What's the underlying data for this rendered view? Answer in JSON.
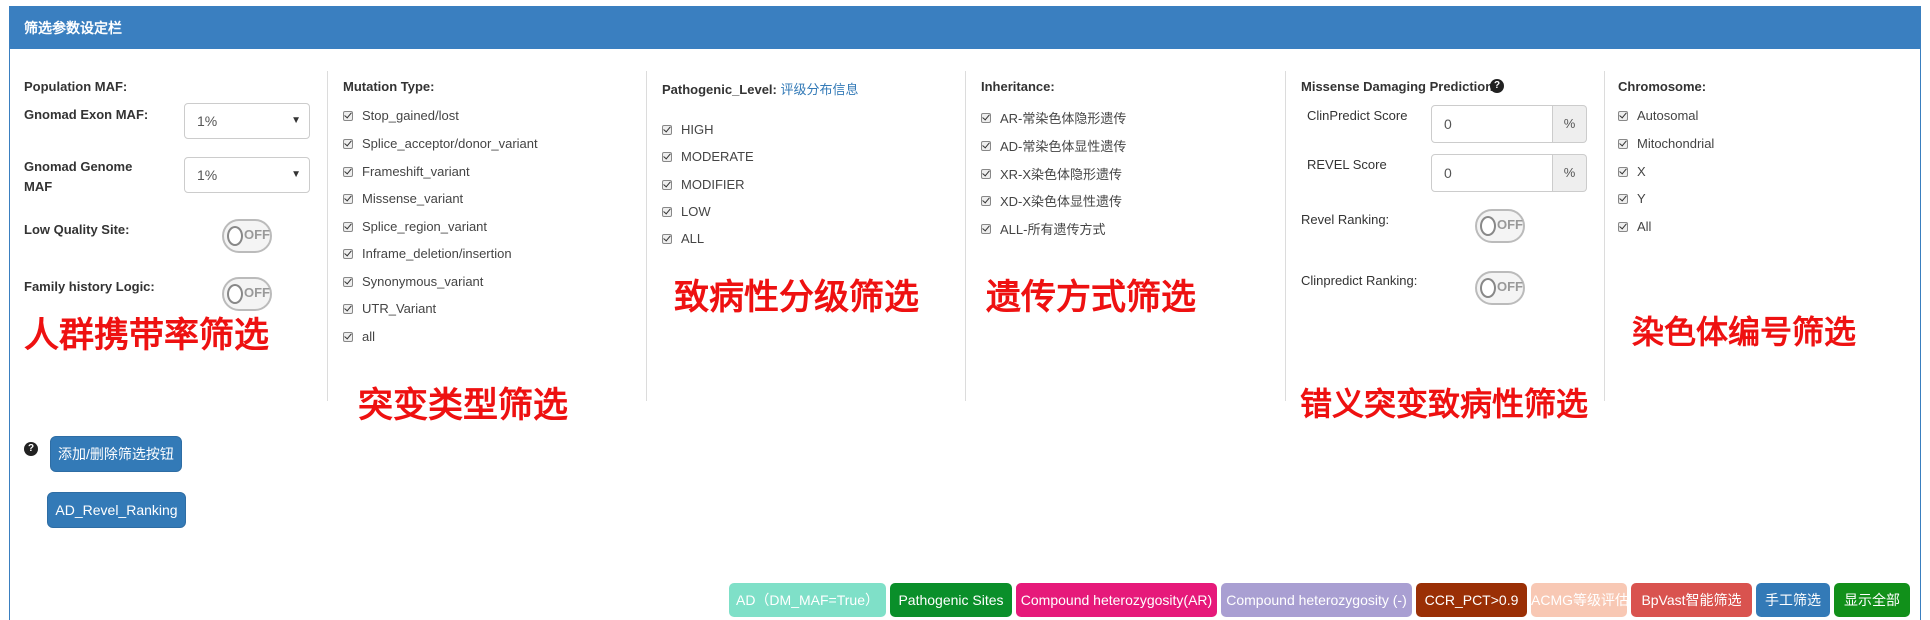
{
  "header": {
    "title": "筛选参数设定栏"
  },
  "population": {
    "title": "Population MAF:",
    "exon_label": "Gnomad Exon MAF:",
    "exon_value": "1%",
    "genome_label_1": "Gnomad Genome",
    "genome_label_2": "MAF",
    "genome_value": "1%",
    "low_quality_label": "Low Quality Site:",
    "family_label": "Family history Logic:",
    "toggle_off": "OFF"
  },
  "mutation": {
    "title": "Mutation Type:",
    "items": [
      "Stop_gained/lost",
      "Splice_acceptor/donor_variant",
      "Frameshift_variant",
      "Missense_variant",
      "Splice_region_variant",
      "Inframe_deletion/insertion",
      "Synonymous_variant",
      "UTR_Variant",
      "all"
    ]
  },
  "pathogenic": {
    "title": "Pathogenic_Level:",
    "link": "评级分布信息",
    "items": [
      "HIGH",
      "MODERATE",
      "MODIFIER",
      "LOW",
      "ALL"
    ]
  },
  "inheritance": {
    "title": "Inheritance:",
    "items": [
      "AR-常染色体隐形遗传",
      "AD-常染色体显性遗传",
      "XR-X染色体隐形遗传",
      "XD-X染色体显性遗传",
      "ALL-所有遗传方式"
    ]
  },
  "missense": {
    "title": "Missense Damaging Prediction:",
    "clinpredict_label": "ClinPredict Score",
    "clinpredict_value": "0",
    "revel_label": "REVEL Score",
    "revel_value": "0",
    "percent": "%",
    "revel_ranking_label": "Revel Ranking:",
    "clinpredict_ranking_label": "Clinpredict Ranking:"
  },
  "chromosome": {
    "title": "Chromosome:",
    "items": [
      "Autosomal",
      "Mitochondrial",
      "X",
      "Y",
      "All"
    ]
  },
  "annotations": {
    "population": "人群携带率筛选",
    "mutation": "突变类型筛选",
    "pathogenic": "致病性分级筛选",
    "inheritance": "遗传方式筛选",
    "missense": "错义突变致病性筛选",
    "chromosome": "染色体编号筛选"
  },
  "buttons": {
    "add_remove": "添加/删除筛选按钮",
    "ad_revel": "AD_Revel_Ranking"
  },
  "filters": [
    {
      "label": "AD（DM_MAF=True）",
      "color": "#7fe0c8"
    },
    {
      "label": "Pathogenic Sites",
      "color": "#0a8f2a"
    },
    {
      "label": "Compound heterozygosity(AR)",
      "color": "#e6197a"
    },
    {
      "label": "Compound heterozygosity (-)",
      "color": "#a99fd2"
    },
    {
      "label": "CCR_PCT>0.9",
      "color": "#9a2f05"
    },
    {
      "label": "ACMG等级评估",
      "color": "#f8c8b4"
    },
    {
      "label": "BpVast智能筛选",
      "color": "#d9534f"
    },
    {
      "label": "手工筛选",
      "color": "#337ab7"
    },
    {
      "label": "显示全部",
      "color": "#11901a"
    }
  ]
}
